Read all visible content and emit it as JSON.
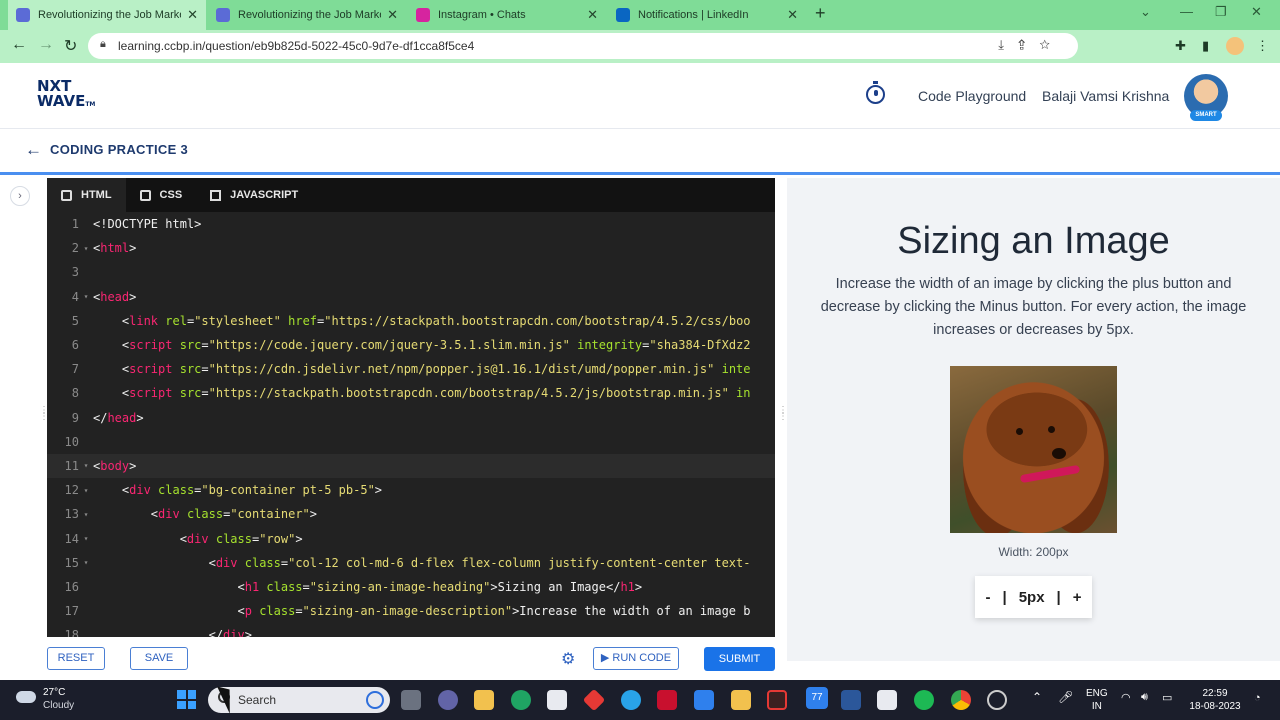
{
  "browser": {
    "tabs": [
      {
        "title": "Revolutionizing the Job Market |",
        "active": true,
        "favicon_color": "#5b6bd6"
      },
      {
        "title": "Revolutionizing the Job Market |",
        "active": false,
        "favicon_color": "#5b6bd6"
      },
      {
        "title": "Instagram • Chats",
        "active": false,
        "favicon_color": "#d6249f"
      },
      {
        "title": "Notifications | LinkedIn",
        "active": false,
        "favicon_color": "#0a66c2"
      }
    ],
    "url": "learning.ccbp.in/question/eb9b825d-5022-45c0-9d7e-df1cca8f5ce4"
  },
  "site": {
    "logo_line1": "NXT",
    "logo_line2": "WAVE",
    "logo_tm": "TM",
    "code_playground": "Code Playground",
    "username": "Balaji Vamsi Krishna",
    "avatar_badge": "SMART"
  },
  "practice": {
    "title": "CODING PRACTICE 3"
  },
  "editor": {
    "tabs": [
      "HTML",
      "CSS",
      "JAVASCRIPT"
    ],
    "active_tab": "HTML",
    "lines": [
      {
        "n": "1",
        "fold": "",
        "html": "&lt;!DOCTYPE html&gt;"
      },
      {
        "n": "2",
        "fold": "▾",
        "html": "&lt;<span class='t'>html</span>&gt;"
      },
      {
        "n": "3",
        "fold": "",
        "html": ""
      },
      {
        "n": "4",
        "fold": "▾",
        "html": "&lt;<span class='t'>head</span>&gt;"
      },
      {
        "n": "5",
        "fold": "",
        "html": "    &lt;<span class='t'>link</span> <span class='a'>rel</span>=<span class='s'>\"stylesheet\"</span> <span class='a'>href</span>=<span class='s'>\"https://stackpath.bootstrapcdn.com/bootstrap/4.5.2/css/boo</span>"
      },
      {
        "n": "6",
        "fold": "",
        "html": "    &lt;<span class='t'>script</span> <span class='a'>src</span>=<span class='s'>\"https://code.jquery.com/jquery-3.5.1.slim.min.js\"</span> <span class='a'>integrity</span>=<span class='s'>\"sha384-DfXdz2</span>"
      },
      {
        "n": "7",
        "fold": "",
        "html": "    &lt;<span class='t'>script</span> <span class='a'>src</span>=<span class='s'>\"https://cdn.jsdelivr.net/npm/popper.js@1.16.1/dist/umd/popper.min.js\"</span> <span class='a'>inte</span>"
      },
      {
        "n": "8",
        "fold": "",
        "html": "    &lt;<span class='t'>script</span> <span class='a'>src</span>=<span class='s'>\"https://stackpath.bootstrapcdn.com/bootstrap/4.5.2/js/bootstrap.min.js\"</span> <span class='a'>in</span>"
      },
      {
        "n": "9",
        "fold": "",
        "html": "&lt;/<span class='t'>head</span>&gt;"
      },
      {
        "n": "10",
        "fold": "",
        "html": ""
      },
      {
        "n": "11",
        "fold": "▾",
        "html": "&lt;<span class='t'>body</span>&gt;"
      },
      {
        "n": "12",
        "fold": "▾",
        "html": "    &lt;<span class='t'>div</span> <span class='a'>class</span>=<span class='s'>\"bg-container pt-5 pb-5\"</span>&gt;"
      },
      {
        "n": "13",
        "fold": "▾",
        "html": "        &lt;<span class='t'>div</span> <span class='a'>class</span>=<span class='s'>\"container\"</span>&gt;"
      },
      {
        "n": "14",
        "fold": "▾",
        "html": "            &lt;<span class='t'>div</span> <span class='a'>class</span>=<span class='s'>\"row\"</span>&gt;"
      },
      {
        "n": "15",
        "fold": "▾",
        "html": "                &lt;<span class='t'>div</span> <span class='a'>class</span>=<span class='s'>\"col-12 col-md-6 d-flex flex-column justify-content-center text-</span>"
      },
      {
        "n": "16",
        "fold": "",
        "html": "                    &lt;<span class='t'>h1</span> <span class='a'>class</span>=<span class='s'>\"sizing-an-image-heading\"</span>&gt;Sizing an Image&lt;/<span class='t'>h1</span>&gt;"
      },
      {
        "n": "17",
        "fold": "",
        "html": "                    &lt;<span class='t'>p</span> <span class='a'>class</span>=<span class='s'>\"sizing-an-image-description\"</span>&gt;Increase the width of an image b"
      },
      {
        "n": "18",
        "fold": "",
        "html": "                &lt;/<span class='t'>div</span>&gt;"
      }
    ],
    "current_line": "11"
  },
  "buttons": {
    "reset": "RESET",
    "save": "SAVE",
    "run_code": "RUN CODE",
    "submit": "SUBMIT"
  },
  "preview": {
    "heading": "Sizing an Image",
    "description": "Increase the width of an image by clicking the plus button and decrease by clicking the Minus button. For every action, the image increases or decreases by 5px.",
    "width_text": "Width: 200px",
    "minus": "-",
    "step": "5px",
    "plus": "+"
  },
  "taskbar": {
    "temperature": "27°C",
    "condition": "Cloudy",
    "search_placeholder": "Search",
    "notification_count": "77",
    "lang_line1": "ENG",
    "lang_line2": "IN",
    "time": "22:59",
    "date": "18-08-2023"
  },
  "colors": {
    "browser_frame": "#7fdc97",
    "accent_blue": "#1a73e8",
    "editor_bg": "#222222",
    "preview_bg": "#f1f3f6"
  }
}
